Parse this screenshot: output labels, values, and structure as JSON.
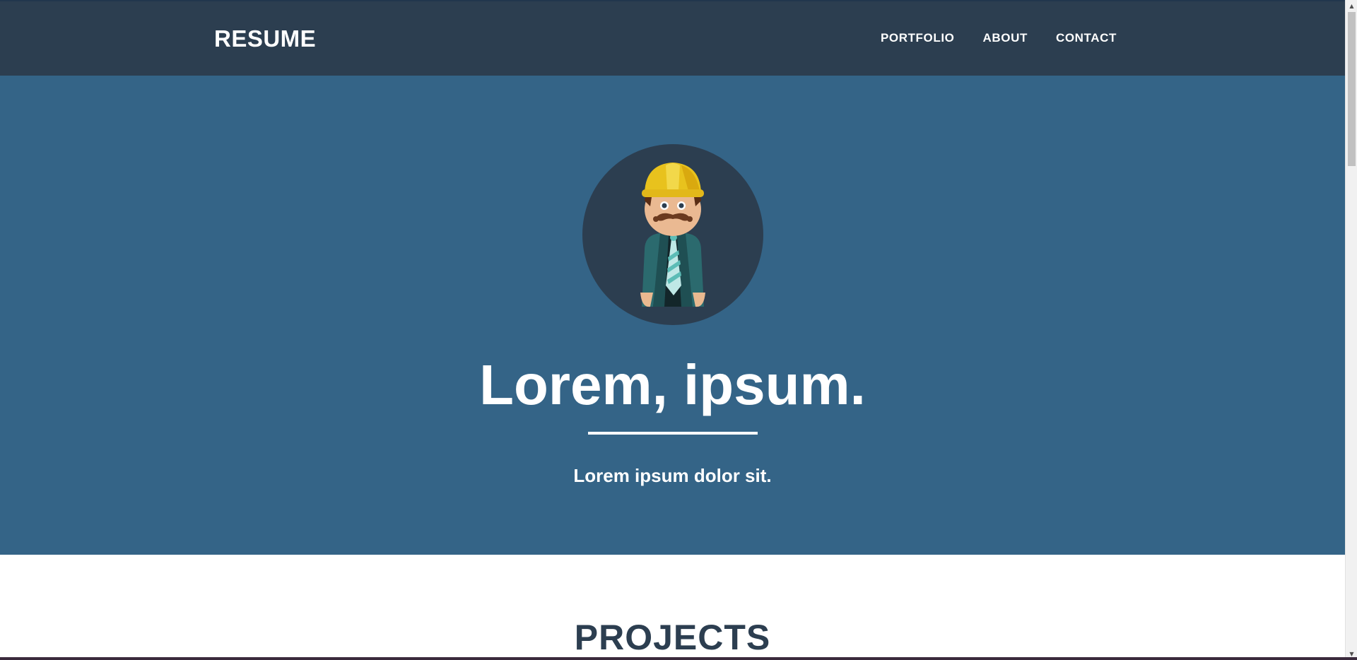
{
  "navbar": {
    "brand": "RESUME",
    "links": [
      "PORTFOLIO",
      "ABOUT",
      "CONTACT"
    ]
  },
  "hero": {
    "avatar_icon": "construction-worker-avatar",
    "title": "Lorem, ipsum.",
    "subtitle": "Lorem ipsum dolor sit."
  },
  "projects": {
    "heading": "PROJECTS"
  },
  "colors": {
    "navbar_bg": "#2c3e50",
    "hero_bg": "#346487",
    "heading_text": "#2c3e50"
  }
}
